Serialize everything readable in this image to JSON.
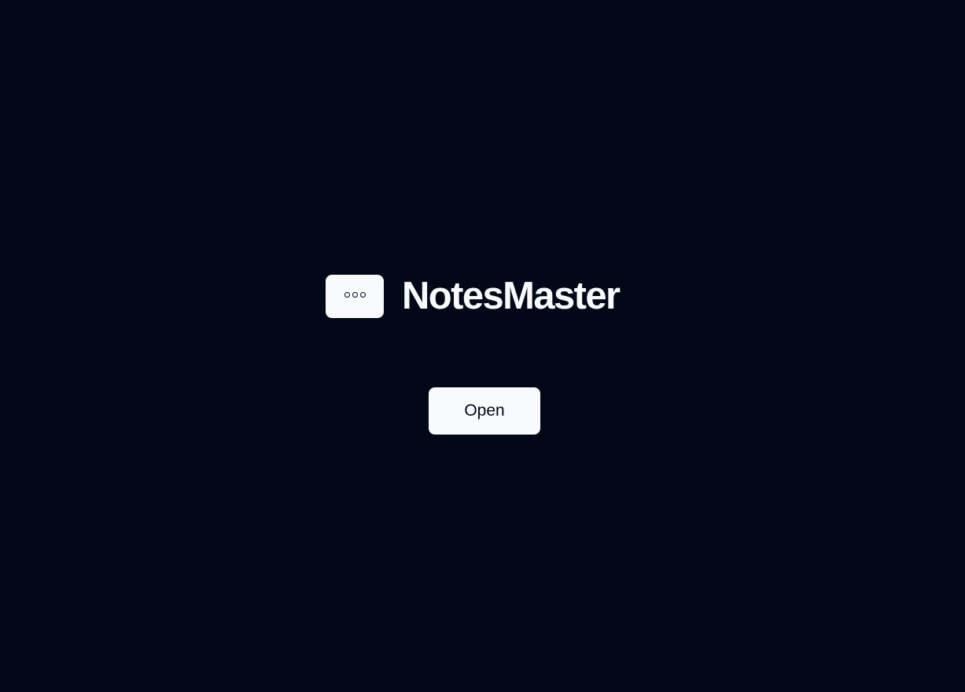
{
  "app": {
    "title": "NotesMaster",
    "logo_icon": "ellipsis-icon"
  },
  "actions": {
    "open_label": "Open"
  },
  "colors": {
    "background": "#020817",
    "foreground": "#f8fafc",
    "button_background": "#f8fafc",
    "button_text": "#020817"
  }
}
